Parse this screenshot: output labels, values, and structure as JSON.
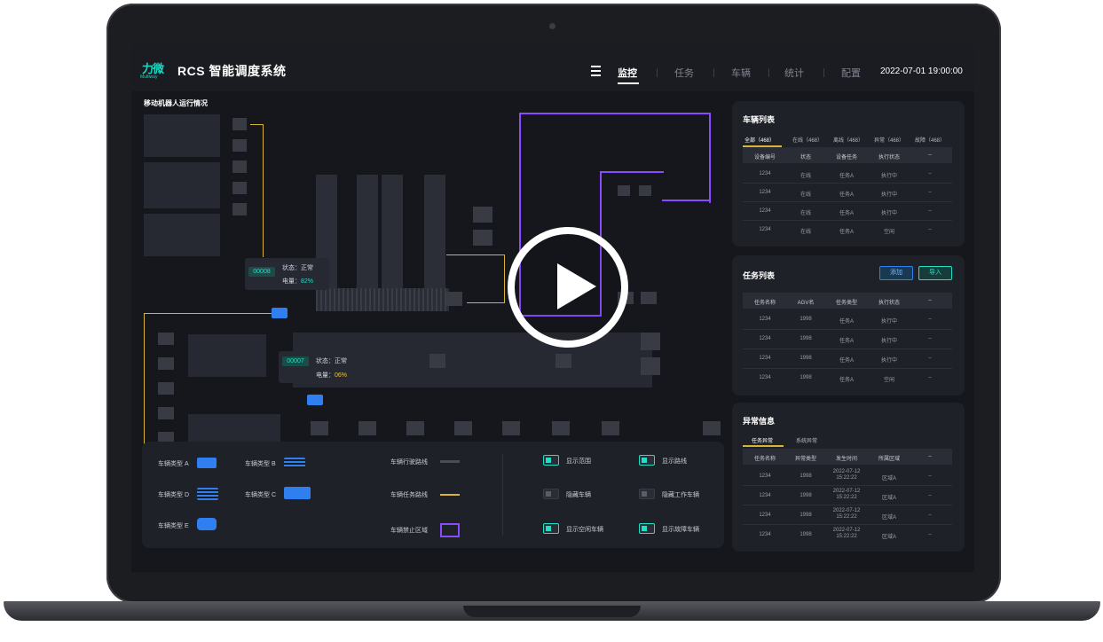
{
  "header": {
    "logo": "力微",
    "logo_sub": "Multiway",
    "title": "RCS 智能调度系统",
    "nav": [
      "监控",
      "任务",
      "车辆",
      "统计",
      "配置"
    ],
    "active_nav": "监控",
    "datetime": "2022-07-01  19:00:00"
  },
  "map": {
    "title": "移动机器人运行情况",
    "robots": [
      {
        "id": "00008",
        "status_label": "状态：",
        "status": "正常",
        "battery_label": "电量：",
        "battery": "82%"
      },
      {
        "id": "00007",
        "status_label": "状态：",
        "status": "正常",
        "battery_label": "电量：",
        "battery": "06%"
      }
    ]
  },
  "legend": {
    "vehicle_types": [
      "车辆类型 A",
      "车辆类型 B",
      "车辆类型 D",
      "车辆类型 C",
      "车辆类型 E"
    ],
    "lines": [
      "车辆行驶路线",
      "车辆任务路线",
      "车辆禁止区域"
    ],
    "toggles": [
      {
        "label": "显示范围",
        "on": true
      },
      {
        "label": "显示路线",
        "on": true
      },
      {
        "label": "隐藏车辆",
        "on": false
      },
      {
        "label": "隐藏工作车辆",
        "on": false
      },
      {
        "label": "显示空闲车辆",
        "on": true
      },
      {
        "label": "显示故障车辆",
        "on": true
      }
    ]
  },
  "vehicle_list": {
    "title": "车辆列表",
    "tabs": [
      "全部（468）",
      "在线（468）",
      "离线（468）",
      "异常（468）",
      "故障（468）"
    ],
    "columns": [
      "设备编号",
      "状态",
      "设备任务",
      "执行状态",
      "--"
    ],
    "rows": [
      [
        "1234",
        "在线",
        "任务A",
        "执行中",
        "--"
      ],
      [
        "1234",
        "在线",
        "任务A",
        "执行中",
        "--"
      ],
      [
        "1234",
        "在线",
        "任务A",
        "执行中",
        "--"
      ],
      [
        "1234",
        "在线",
        "任务A",
        "空闲",
        "--"
      ]
    ]
  },
  "task_list": {
    "title": "任务列表",
    "buttons": [
      "添加",
      "导入"
    ],
    "columns": [
      "任务名称",
      "AGV名",
      "任务类型",
      "执行状态",
      "--"
    ],
    "rows": [
      [
        "1234",
        "1998",
        "任务A",
        "执行中",
        "--"
      ],
      [
        "1234",
        "1998",
        "任务A",
        "执行中",
        "--"
      ],
      [
        "1234",
        "1998",
        "任务A",
        "执行中",
        "--"
      ],
      [
        "1234",
        "1998",
        "任务A",
        "空闲",
        "--"
      ]
    ]
  },
  "alerts": {
    "title": "异常信息",
    "tabs": [
      "任务异常",
      "系统异常"
    ],
    "columns": [
      "任务名称",
      "异常类型",
      "发生时间",
      "所属区域",
      "--"
    ],
    "rows": [
      [
        "1234",
        "1998",
        "2022-07-12 15:22:22",
        "区域A",
        "--"
      ],
      [
        "1234",
        "1998",
        "2022-07-12 15:22:22",
        "区域A",
        "--"
      ],
      [
        "1234",
        "1998",
        "2022-07-12 15:22:22",
        "区域A",
        "--"
      ],
      [
        "1234",
        "1998",
        "2022-07-12 15:22:22",
        "区域A",
        "--"
      ]
    ]
  },
  "colors": {
    "accent": "#1fe0c6",
    "route": "#d9b23a",
    "forbidden": "#8a4bff",
    "vehicle": "#2f7ff0"
  },
  "video": {
    "play_icon": "play-icon"
  }
}
